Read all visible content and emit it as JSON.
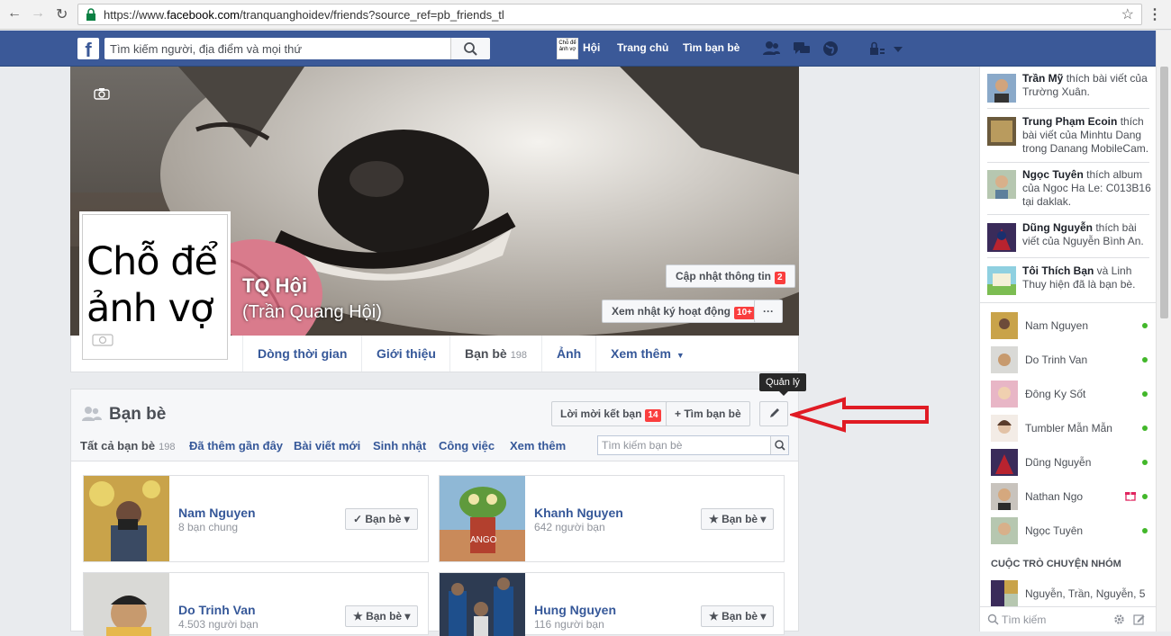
{
  "browser": {
    "url_prefix": "https://www.",
    "url_host": "facebook.com",
    "url_path": "/tranquanghoidev/friends?source_ref=pb_friends_tl"
  },
  "topbar": {
    "logo": "f",
    "search_placeholder": "Tìm kiếm người, địa điểm và mọi thứ",
    "avatar_text": "Chỗ để ảnh vợ",
    "profile_link": "Hội",
    "home": "Trang chủ",
    "find_friends": "Tìm bạn bè"
  },
  "profile": {
    "picture_text": "Chỗ để ảnh vợ",
    "name": "TQ Hội",
    "alt_name": "(Trần Quang Hội)",
    "update_info": "Cập nhật thông tin",
    "update_info_badge": "2",
    "activity_log": "Xem nhật ký hoạt động",
    "activity_log_badge": "10+",
    "more": "···"
  },
  "timeline_tabs": [
    {
      "label": "Dòng thời gian"
    },
    {
      "label": "Giới thiệu"
    },
    {
      "label": "Bạn bè",
      "count": "198"
    },
    {
      "label": "Ảnh"
    },
    {
      "label": "Xem thêm"
    }
  ],
  "friends": {
    "title": "Bạn bè",
    "requests": "Lời mời kết bạn",
    "requests_badge": "14",
    "find": "+ Tìm bạn bè",
    "tooltip": "Quản lý",
    "search_placeholder": "Tìm kiếm bạn bè",
    "subtabs": [
      {
        "label": "Tất cả bạn bè",
        "count": "198"
      },
      {
        "label": "Đã thêm gần đây"
      },
      {
        "label": "Bài viết mới"
      },
      {
        "label": "Sinh nhật"
      },
      {
        "label": "Công việc"
      },
      {
        "label": "Xem thêm"
      }
    ],
    "cards": [
      {
        "name": "Nam Nguyen",
        "sub": "8 bạn chung",
        "button": "✓ Bạn bè ▾"
      },
      {
        "name": "Khanh Nguyen",
        "sub": "642 người bạn",
        "button": "★ Bạn bè ▾"
      },
      {
        "name": "Do Trinh Van",
        "sub": "4.503 người bạn",
        "button": "★ Bạn bè ▾"
      },
      {
        "name": "Hung Nguyen",
        "sub": "116 người bạn",
        "button": "★ Bạn bè ▾"
      }
    ]
  },
  "ticker": [
    {
      "name": "Trần Mỹ",
      "text": " thích bài viết của Trường Xuân."
    },
    {
      "name": "Trung Phạm Ecoin",
      "text": " thích bài viết của Minhtu Dang trong Danang MobileCam."
    },
    {
      "name": "Ngọc Tuyên",
      "text": " thích album của Ngoc Ha Le: C013B16 tại daklak."
    },
    {
      "name": "Dũng Nguyễn",
      "text": " thích bài viết của Nguyễn Bình An."
    },
    {
      "name": "Tôi Thích Bạn",
      "text": " và Linh Thuy hiện đã là bạn bè."
    }
  ],
  "chat": [
    {
      "name": "Nam Nguyen"
    },
    {
      "name": "Do Trinh Van"
    },
    {
      "name": "Đông Ky Sốt"
    },
    {
      "name": "Tumbler Mẫn Mẫn"
    },
    {
      "name": "Dũng Nguyễn"
    },
    {
      "name": "Nathan Ngo"
    },
    {
      "name": "Ngọc Tuyên"
    }
  ],
  "chat_group_heading": "CUỘC TRÒ CHUYỆN NHÓM",
  "chat_group": "Nguyễn, Trần, Nguyễn, 5 ...",
  "chat_search_placeholder": "Tìm kiếm",
  "colors": {
    "fb_blue": "#3b5998",
    "link": "#365899",
    "online": "#42b72a",
    "badge": "#fa3e3e"
  }
}
